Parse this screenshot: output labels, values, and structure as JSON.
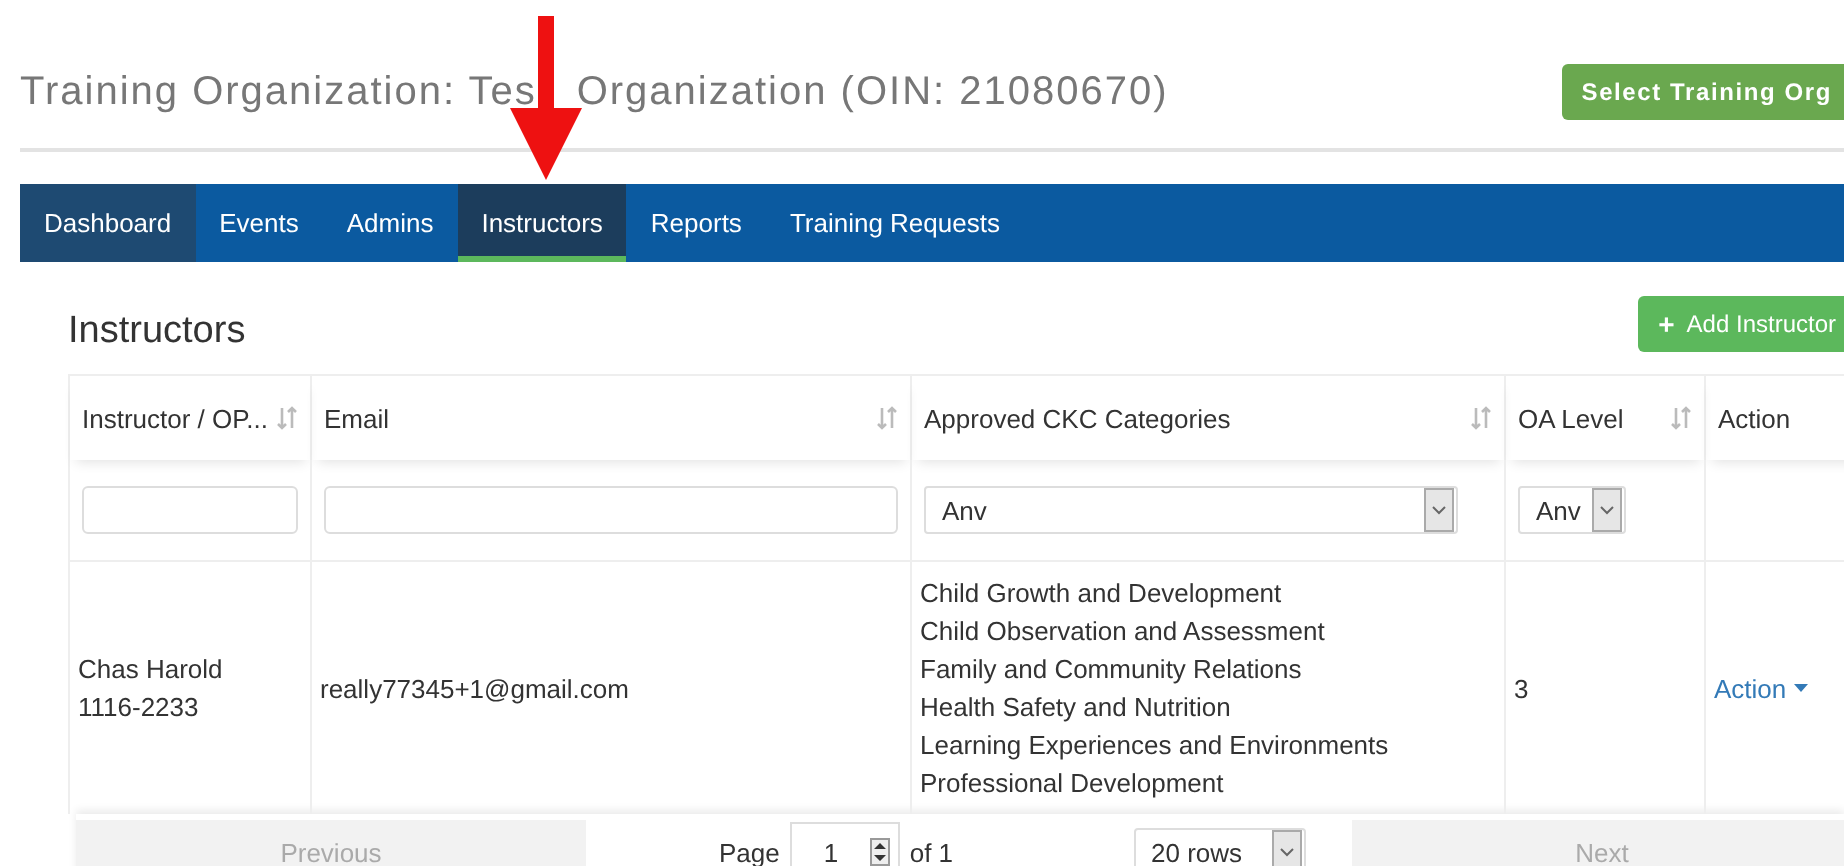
{
  "page_title": [
    "Training Organization: Tes",
    "Organization (OIN: 21080670)"
  ],
  "select_org_button": "Select Training Org",
  "tabs": [
    {
      "label": "Dashboard",
      "selected": false,
      "hovered": true
    },
    {
      "label": "Events",
      "selected": false,
      "hovered": false
    },
    {
      "label": "Admins",
      "selected": false,
      "hovered": false
    },
    {
      "label": "Instructors",
      "selected": true,
      "hovered": false
    },
    {
      "label": "Reports",
      "selected": false,
      "hovered": false
    },
    {
      "label": "Training Requests",
      "selected": false,
      "hovered": false
    }
  ],
  "section_title": "Instructors",
  "add_button": {
    "icon": "+",
    "label": "Add Instructor"
  },
  "table": {
    "columns": [
      {
        "label": "Instructor / OP...",
        "sortable": true,
        "kind": "text"
      },
      {
        "label": "Email",
        "sortable": true,
        "kind": "text"
      },
      {
        "label": "Approved CKC Categories",
        "sortable": true,
        "kind": "select",
        "value": "Anv"
      },
      {
        "label": "OA Level",
        "sortable": true,
        "kind": "select",
        "value": "Anv"
      },
      {
        "label": "Action",
        "sortable": false,
        "kind": "none"
      }
    ],
    "rows": [
      {
        "instructor": [
          "Chas Harold",
          "1116-2233"
        ],
        "email": "really77345+1@gmail.com",
        "categories": [
          "Child Growth and Development",
          "Child Observation and Assessment",
          "Family and Community Relations",
          "Health Safety and Nutrition",
          "Learning Experiences and Environments",
          "Professional Development"
        ],
        "oa_level": "3",
        "action": "Action"
      }
    ]
  },
  "pagination": {
    "previous": "Previous",
    "page_label": "Page",
    "page": "1",
    "of": "of 1",
    "rows": "20 rows",
    "next": "Next",
    "previous_disabled": true,
    "next_disabled": true
  }
}
